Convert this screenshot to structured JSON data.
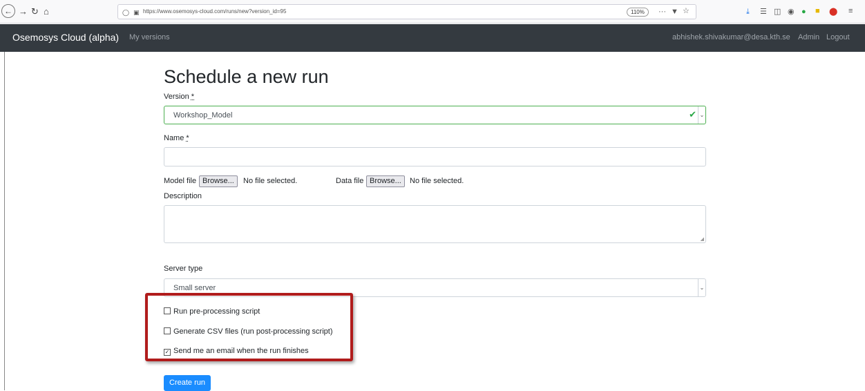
{
  "browser": {
    "url": "https://www.osemosys-cloud.com/runs/new?version_id=95",
    "zoom": "110%",
    "more_glyph": "···"
  },
  "navbar": {
    "brand": "Osemosys Cloud (alpha)",
    "my_versions": "My versions",
    "user_email": "abhishek.shivakumar@desa.kth.se",
    "admin": "Admin",
    "logout": "Logout"
  },
  "form": {
    "title": "Schedule a new run",
    "version_label": "Version",
    "required_mark": "*",
    "version_value": "Workshop_Model",
    "name_label": "Name",
    "model_file_label": "Model file",
    "data_file_label": "Data file",
    "browse_label": "Browse...",
    "no_file_text": "No file selected.",
    "description_label": "Description",
    "server_type_label": "Server type",
    "server_type_value": "Small server",
    "checkboxes": [
      {
        "label": "Run pre-processing script",
        "checked": false
      },
      {
        "label": "Generate CSV files (run post-processing script)",
        "checked": false
      },
      {
        "label": "Send me an email when the run finishes",
        "checked": true
      }
    ],
    "submit_label": "Create run"
  },
  "colors": {
    "navbar_bg": "#343a40",
    "primary_button": "#1a8cff",
    "highlight_border": "#b01c1c",
    "valid_green": "#28a745"
  }
}
